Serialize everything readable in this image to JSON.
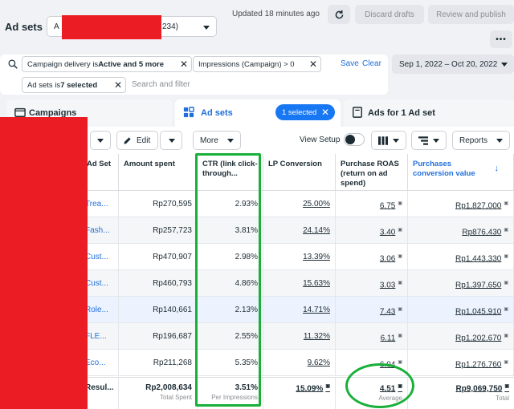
{
  "header": {
    "title": "Ad sets",
    "account_prefix": "A",
    "account_suffix": "234)",
    "updated": "Updated 18 minutes ago",
    "discard_label": "Discard drafts",
    "publish_label": "Review and publish",
    "more_label": "•••"
  },
  "filters": {
    "chips": [
      {
        "pre": "Campaign delivery is ",
        "bold": "Active and 5 more"
      },
      {
        "pre": "Impressions (Campaign) > 0",
        "bold": ""
      },
      {
        "pre": "Ad sets is ",
        "bold": "7 selected"
      }
    ],
    "save_label": "Save",
    "clear_label": "Clear",
    "placeholder": "Search and filter",
    "date_range": "Sep 1, 2022 – Oct 20, 2022"
  },
  "tabs": {
    "campaigns": "Campaigns",
    "adsets": "Ad sets",
    "selected_badge": "1 selected",
    "ads": "Ads for 1 Ad set"
  },
  "toolbar": {
    "edit_label": "Edit",
    "more_label": "More",
    "view_setup_label": "View Setup",
    "reports_label": "Reports"
  },
  "table": {
    "headers": {
      "name": "Ad Set",
      "amount": "Amount spent",
      "ctr": "CTR (link click-through...",
      "lp": "LP Conversion",
      "roas": "Purchase ROAS (return on ad spend)",
      "value": "Purchases conversion value"
    },
    "rows": [
      {
        "name": "Trea...",
        "amount": "Rp270,595",
        "ctr": "2.93%",
        "lp": "25.00%",
        "roas": "6.75",
        "value": "Rp1,827,000"
      },
      {
        "name": "Fash...",
        "amount": "Rp257,723",
        "ctr": "3.81%",
        "lp": "24.14%",
        "roas": "3.40",
        "value": "Rp876,430"
      },
      {
        "name": "Cust...",
        "amount": "Rp470,907",
        "ctr": "2.98%",
        "lp": "13.39%",
        "roas": "3.06",
        "value": "Rp1,443,330"
      },
      {
        "name": "Cust...",
        "amount": "Rp460,793",
        "ctr": "4.86%",
        "lp": "15.63%",
        "roas": "3.03",
        "value": "Rp1,397,650"
      },
      {
        "name": "Role...",
        "amount": "Rp140,661",
        "ctr": "2.13%",
        "lp": "14.71%",
        "roas": "7.43",
        "value": "Rp1,045,910"
      },
      {
        "name": "FLE...",
        "amount": "Rp196,687",
        "ctr": "2.55%",
        "lp": "11.32%",
        "roas": "6.11",
        "value": "Rp1,202,670"
      },
      {
        "name": "Eco...",
        "amount": "Rp211,268",
        "ctr": "5.35%",
        "lp": "9.62%",
        "roas": "6.04",
        "value": "Rp1,276,760"
      }
    ],
    "totals": {
      "name": "Resul...",
      "amount": "Rp2,008,634",
      "amount_sub": "Total Spent",
      "ctr": "3.51%",
      "ctr_sub": "Per Impressions",
      "lp": "15.09%",
      "roas": "4.51",
      "roas_sub": "Average",
      "value": "Rp9,069,750",
      "value_sub": "Total"
    }
  },
  "colors": {
    "accent": "#1877f2",
    "link": "#216fdb",
    "redaction": "#ec1c24",
    "annotation_green": "#18b038"
  }
}
